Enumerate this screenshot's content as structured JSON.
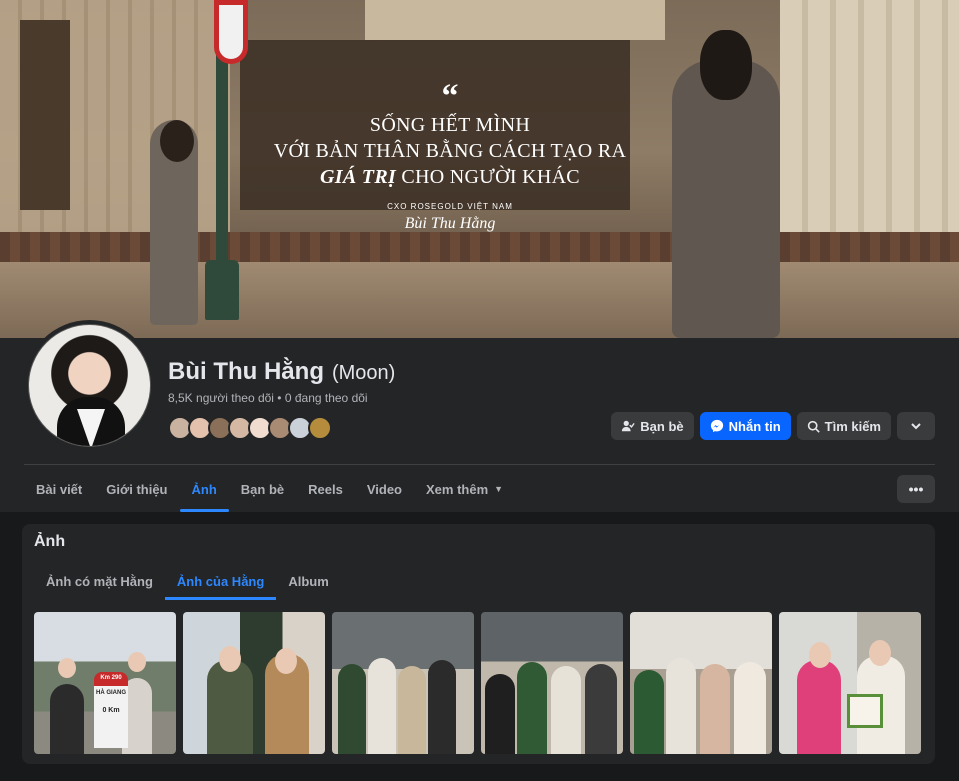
{
  "cover": {
    "quote_lines": [
      "SỐNG HẾT MÌNH",
      "VỚI BẢN THÂN BẰNG CÁCH TẠO RA"
    ],
    "quote_emph": "GIÁ TRỊ",
    "quote_tail": " CHO NGƯỜI KHÁC",
    "caption": "CXO ROSEGOLD VIỆT NAM",
    "signature": "Bùi Thu Hằng"
  },
  "profile": {
    "name": "Bùi Thu Hằng",
    "alt_name": "(Moon)",
    "followers_line": "8,5K người theo dõi • 0 đang theo dõi",
    "friend_avatar_colors": [
      "#c9b2a0",
      "#e3c1ad",
      "#8a7058",
      "#d4b8a4",
      "#f0ddd0",
      "#a98a72",
      "#cbd1d8",
      "#b58c3c"
    ]
  },
  "actions": {
    "friends": "Bạn bè",
    "message": "Nhắn tin",
    "search": "Tìm kiếm"
  },
  "tabs": [
    "Bài viết",
    "Giới thiệu",
    "Ảnh",
    "Bạn bè",
    "Reels",
    "Video",
    "Xem thêm"
  ],
  "photos": {
    "title": "Ảnh",
    "subtabs": [
      "Ảnh có mặt Hằng",
      "Ảnh của Hằng",
      "Album"
    ],
    "milestone_sign": [
      "Km 290",
      "HÀ GIANG",
      "0 Km"
    ]
  },
  "colors": {
    "accent": "#2d88ff",
    "primary_button": "#0866ff",
    "background": "#18191a",
    "surface": "#242526"
  }
}
